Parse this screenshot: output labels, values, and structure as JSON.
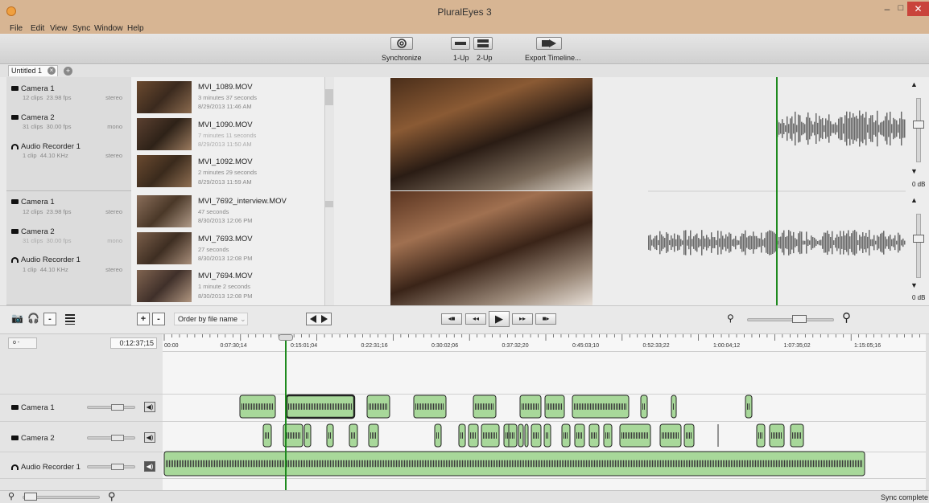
{
  "window": {
    "title": "PluralEyes 3",
    "min": "–",
    "max": "□",
    "close": "✕"
  },
  "menu": [
    "File",
    "Edit",
    "View",
    "Sync",
    "Window",
    "Help"
  ],
  "toolbar": {
    "synchronize": "Synchronize",
    "layout_1up": "1-Up",
    "layout_2up": "2-Up",
    "export": "Export Timeline..."
  },
  "tabs": {
    "untitled": "Untitled 1",
    "close": "×",
    "add": "+"
  },
  "group1": {
    "sources": [
      {
        "name": "Camera 1",
        "clips": "12 clips",
        "fps": "23.98 fps",
        "mode": "stereo",
        "icon": "camera-icon"
      },
      {
        "name": "Camera 2",
        "clips": "31 clips",
        "fps": "30.00 fps",
        "mode": "mono",
        "icon": "camera-icon"
      },
      {
        "name": "Audio Recorder 1",
        "clips": "1 clip",
        "fps": "44.10 KHz",
        "mode": "stereo",
        "icon": "headphones-icon"
      }
    ],
    "clips": [
      {
        "title": "MVI_1089.MOV",
        "duration": "3 minutes 37 seconds",
        "date": "8/29/2013 11:46 AM"
      },
      {
        "title": "MVI_1090.MOV",
        "duration": "7 minutes 11 seconds",
        "date": "8/29/2013 11:50 AM"
      },
      {
        "title": "MVI_1092.MOV",
        "duration": "2 minutes 29 seconds",
        "date": "8/29/2013 11:59 AM"
      }
    ]
  },
  "group2": {
    "sources": [
      {
        "name": "Camera 1",
        "clips": "12 clips",
        "fps": "23.98 fps",
        "mode": "stereo",
        "icon": "camera-icon"
      },
      {
        "name": "Camera 2",
        "clips": "31 clips",
        "fps": "30.00 fps",
        "mode": "mono",
        "icon": "camera-icon"
      },
      {
        "name": "Audio Recorder 1",
        "clips": "1 clip",
        "fps": "44.10 KHz",
        "mode": "stereo",
        "icon": "headphones-icon"
      }
    ],
    "clips": [
      {
        "title": "MVI_7692_interview.MOV",
        "duration": "47 seconds",
        "date": "8/30/2013 12:06 PM"
      },
      {
        "title": "MVI_7693.MOV",
        "duration": "27 seconds",
        "date": "8/30/2013 12:08 PM"
      },
      {
        "title": "MVI_7694.MOV",
        "duration": "1 minute 2 seconds",
        "date": "8/30/2013 12:08 PM"
      }
    ]
  },
  "volume": {
    "top_db": "0 dB",
    "bottom_db": "0 dB"
  },
  "controls": {
    "add": "+",
    "remove": "-",
    "order_by": "Order by file name",
    "remove_source": "-"
  },
  "timeline": {
    "current_time": "0:12:37;15",
    "small_btn": "o -",
    "ticks": [
      "00:00",
      "0:07:30;14",
      "0:15:01;04",
      "0:22:31;16",
      "0:30:02;06",
      "0:37:32;20",
      "0:45:03;10",
      "0:52:33;22",
      "1:00:04;12",
      "1:07:35;02",
      "1:15:05;16"
    ],
    "tracks": [
      {
        "name": "Camera 1",
        "icon": "camera-icon"
      },
      {
        "name": "Camera 2",
        "icon": "camera-icon"
      },
      {
        "name": "Audio Recorder 1",
        "icon": "headphones-icon"
      }
    ],
    "playhead_fraction": 0.168
  },
  "status": {
    "text": "Sync complete"
  },
  "colors": {
    "clip_fill": "#a8d89a",
    "playhead": "#1e8a1e",
    "title_bar": "#d7b593"
  }
}
